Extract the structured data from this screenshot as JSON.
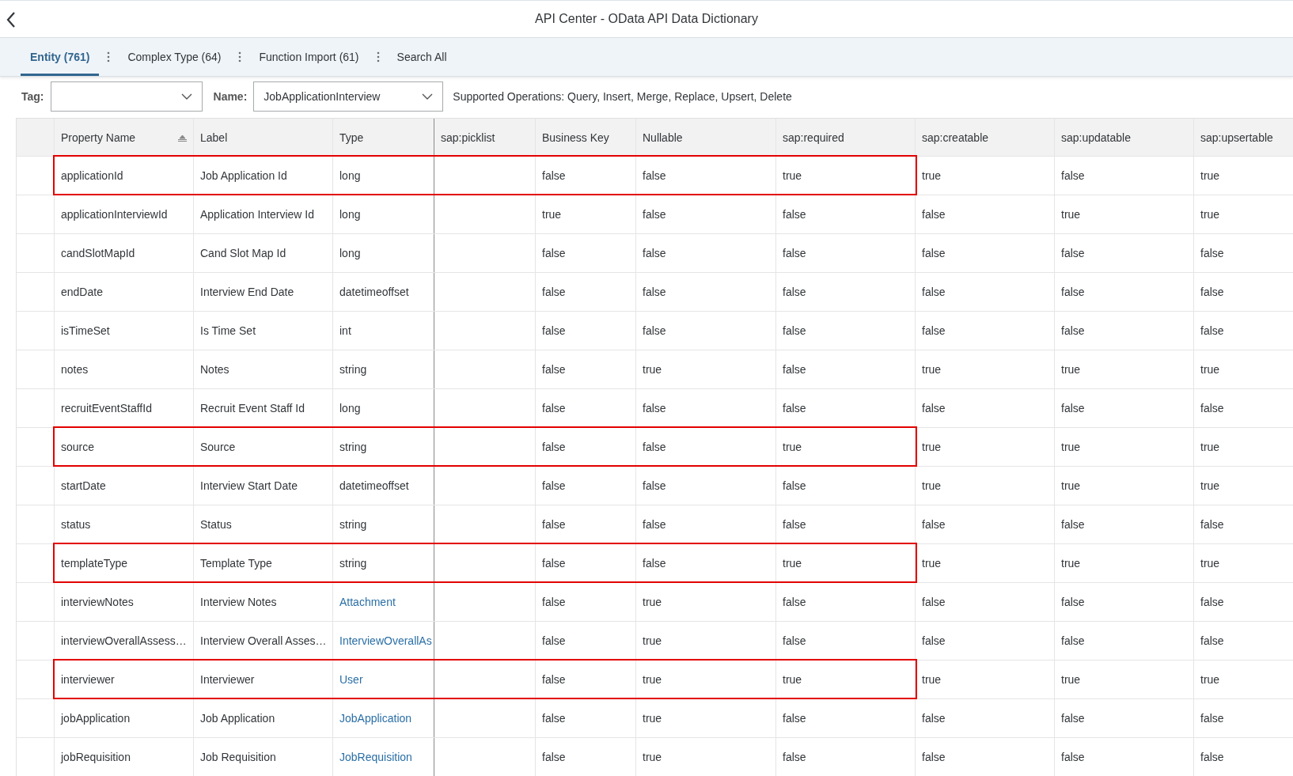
{
  "header": {
    "title": "API Center - OData API Data Dictionary"
  },
  "tabs": [
    {
      "label": "Entity (761)",
      "selected": true
    },
    {
      "label": "Complex Type (64)",
      "selected": false
    },
    {
      "label": "Function Import (61)",
      "selected": false
    },
    {
      "label": "Search All",
      "selected": false
    }
  ],
  "filters": {
    "tag_label": "Tag:",
    "name_label": "Name:",
    "name_value": "JobApplicationInterview",
    "operations": "Supported Operations: Query, Insert, Merge, Replace, Upsert, Delete"
  },
  "table": {
    "columns": [
      "Property Name",
      "Label",
      "Type",
      "sap:picklist",
      "Business Key",
      "Nullable",
      "sap:required",
      "sap:creatable",
      "sap:updatable",
      "sap:upsertable"
    ],
    "rows": [
      {
        "cells": [
          "applicationId",
          "Job Application Id",
          "long",
          "",
          "false",
          "false",
          "true",
          "true",
          "false",
          "true"
        ],
        "type_link": false,
        "highlighted": true
      },
      {
        "cells": [
          "applicationInterviewId",
          "Application Interview Id",
          "long",
          "",
          "true",
          "false",
          "false",
          "false",
          "true",
          "true"
        ],
        "type_link": false,
        "highlighted": false
      },
      {
        "cells": [
          "candSlotMapId",
          "Cand Slot Map Id",
          "long",
          "",
          "false",
          "false",
          "false",
          "false",
          "false",
          "false"
        ],
        "type_link": false,
        "highlighted": false
      },
      {
        "cells": [
          "endDate",
          "Interview End Date",
          "datetimeoffset",
          "",
          "false",
          "false",
          "false",
          "false",
          "false",
          "false"
        ],
        "type_link": false,
        "highlighted": false
      },
      {
        "cells": [
          "isTimeSet",
          "Is Time Set",
          "int",
          "",
          "false",
          "false",
          "false",
          "false",
          "false",
          "false"
        ],
        "type_link": false,
        "highlighted": false
      },
      {
        "cells": [
          "notes",
          "Notes",
          "string",
          "",
          "false",
          "true",
          "false",
          "true",
          "true",
          "true"
        ],
        "type_link": false,
        "highlighted": false
      },
      {
        "cells": [
          "recruitEventStaffId",
          "Recruit Event Staff Id",
          "long",
          "",
          "false",
          "false",
          "false",
          "false",
          "false",
          "false"
        ],
        "type_link": false,
        "highlighted": false
      },
      {
        "cells": [
          "source",
          "Source",
          "string",
          "",
          "false",
          "false",
          "true",
          "true",
          "true",
          "true"
        ],
        "type_link": false,
        "highlighted": true
      },
      {
        "cells": [
          "startDate",
          "Interview Start Date",
          "datetimeoffset",
          "",
          "false",
          "false",
          "false",
          "true",
          "true",
          "true"
        ],
        "type_link": false,
        "highlighted": false
      },
      {
        "cells": [
          "status",
          "Status",
          "string",
          "",
          "false",
          "false",
          "false",
          "false",
          "false",
          "false"
        ],
        "type_link": false,
        "highlighted": false
      },
      {
        "cells": [
          "templateType",
          "Template Type",
          "string",
          "",
          "false",
          "false",
          "true",
          "true",
          "true",
          "true"
        ],
        "type_link": false,
        "highlighted": true
      },
      {
        "cells": [
          "interviewNotes",
          "Interview Notes",
          "Attachment",
          "",
          "false",
          "true",
          "false",
          "false",
          "false",
          "false"
        ],
        "type_link": true,
        "highlighted": false
      },
      {
        "cells": [
          "interviewOverallAssess…",
          "Interview Overall Asses…",
          "InterviewOverallAs",
          "",
          "false",
          "true",
          "false",
          "false",
          "false",
          "false"
        ],
        "type_link": true,
        "highlighted": false
      },
      {
        "cells": [
          "interviewer",
          "Interviewer",
          "User",
          "",
          "false",
          "true",
          "true",
          "true",
          "true",
          "true"
        ],
        "type_link": true,
        "highlighted": true
      },
      {
        "cells": [
          "jobApplication",
          "Job Application",
          "JobApplication",
          "",
          "false",
          "true",
          "false",
          "false",
          "false",
          "false"
        ],
        "type_link": true,
        "highlighted": false
      },
      {
        "cells": [
          "jobRequisition",
          "Job Requisition",
          "JobRequisition",
          "",
          "false",
          "true",
          "false",
          "false",
          "false",
          "false"
        ],
        "type_link": true,
        "highlighted": false
      }
    ]
  }
}
